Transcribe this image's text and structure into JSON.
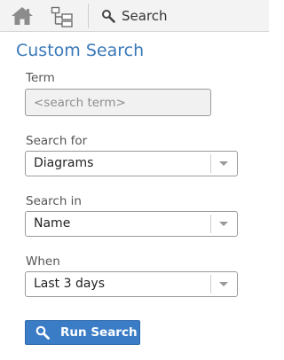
{
  "toolbar": {
    "home_icon": "home-icon",
    "tree_icon": "tree-view-icon",
    "search_icon": "magnifier-icon",
    "search_label": "Search"
  },
  "panel": {
    "title": "Custom Search",
    "term": {
      "label": "Term",
      "value": "",
      "placeholder": "<search term>"
    },
    "search_for": {
      "label": "Search for",
      "selected": "Diagrams"
    },
    "search_in": {
      "label": "Search in",
      "selected": "Name"
    },
    "when": {
      "label": "When",
      "selected": "Last 3 days"
    },
    "run_button": {
      "label": "Run Search",
      "icon": "magnifier-icon"
    }
  },
  "colors": {
    "accent": "#3a78b8",
    "button": "#3a7cc6",
    "toolbar_bg": "#f3f3f3"
  }
}
